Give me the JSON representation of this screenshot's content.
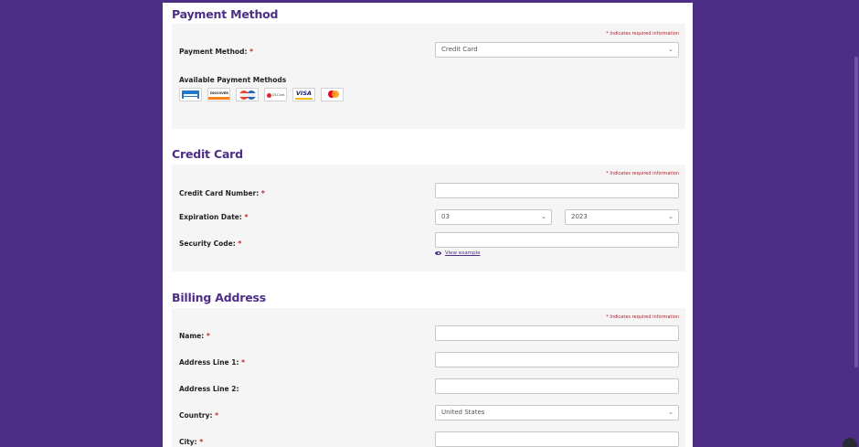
{
  "required_note": "* Indicates required information",
  "payment": {
    "title": "Payment Method",
    "method_label": "Payment Method:",
    "method_value": "Credit Card",
    "available_label": "Available Payment Methods",
    "cards": [
      "amex-card-icon",
      "discover-card-icon",
      "diners-club-card-icon",
      "dccard-icon",
      "visa-card-icon",
      "mastercard-icon"
    ],
    "dccard_text": "DCCard",
    "discover_text": "DISCOVER",
    "visa_text": "VISA"
  },
  "credit_card": {
    "title": "Credit Card",
    "number_label": "Credit Card Number:",
    "expiration_label": "Expiration Date:",
    "exp_month": "03",
    "exp_year": "2023",
    "security_label": "Security Code:",
    "view_example": "View example"
  },
  "billing": {
    "title": "Billing Address",
    "name_label": "Name:",
    "address1_label": "Address Line 1:",
    "address2_label": "Address Line 2:",
    "country_label": "Country:",
    "country_value": "United States",
    "city_label": "City:"
  },
  "required_star": "*",
  "colors": {
    "brand": "#4d2e87",
    "required": "#c0272d",
    "panel": "#f5f5f5"
  }
}
